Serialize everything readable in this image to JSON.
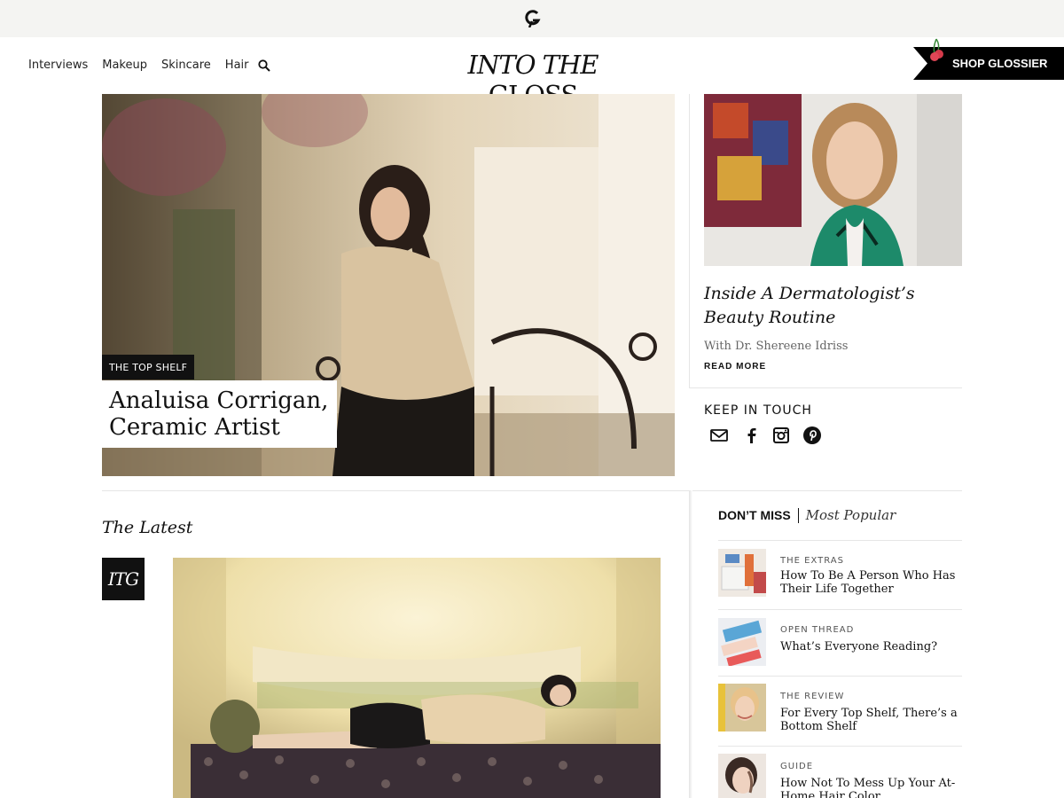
{
  "brand": {
    "wordmark_italic": "INTO THE",
    "wordmark_rest": "GLOSS",
    "shop_label": "SHOP GLOSSIER"
  },
  "nav": {
    "items": [
      {
        "label": "Interviews"
      },
      {
        "label": "Makeup"
      },
      {
        "label": "Skincare"
      },
      {
        "label": "Hair"
      }
    ],
    "search_icon": "search-icon"
  },
  "hero": {
    "tag": "THE TOP SHELF",
    "title": "Analuisa Corrigan, Ceramic Artist"
  },
  "side_feature": {
    "title": "Inside A Dermatologist’s Beauty Routine",
    "subtitle": "With Dr. Shereene Idriss",
    "read_more": "READ MORE"
  },
  "keep_in_touch": {
    "heading": "KEEP IN TOUCH",
    "icons": [
      "mail-icon",
      "facebook-icon",
      "instagram-icon",
      "pinterest-icon"
    ]
  },
  "latest": {
    "heading": "The Latest",
    "badge": "ITG"
  },
  "popular": {
    "tab_dont_miss": "DON’T MISS",
    "tab_most_popular": "Most Popular",
    "items": [
      {
        "category": "THE EXTRAS",
        "title": "How To Be A Person Who Has Their Life Together"
      },
      {
        "category": "OPEN THREAD",
        "title": "What’s Everyone Reading?"
      },
      {
        "category": "THE REVIEW",
        "title": "For Every Top Shelf, There’s a Bottom Shelf"
      },
      {
        "category": "GUIDE",
        "title": "How Not To Mess Up Your At-Home Hair Color"
      }
    ]
  },
  "colors": {
    "topbar": "#f4f4f2",
    "black": "#111111",
    "rule": "#e6e6e6"
  }
}
